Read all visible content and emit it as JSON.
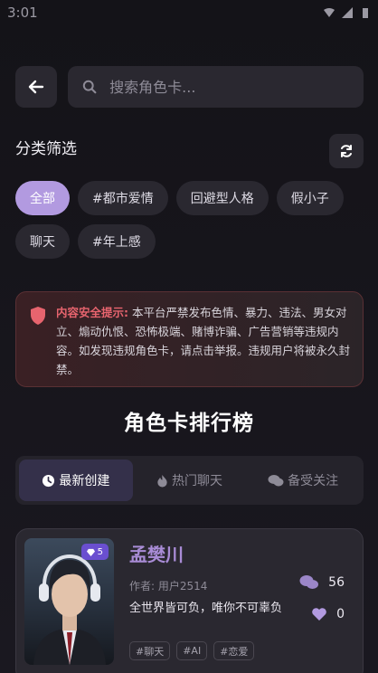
{
  "statusbar": {
    "time": "3:01"
  },
  "search": {
    "placeholder": "搜索角色卡..."
  },
  "filter": {
    "title": "分类筛选"
  },
  "chips": [
    {
      "label": "全部",
      "active": true
    },
    {
      "label": "#都市爱情",
      "active": false
    },
    {
      "label": "回避型人格",
      "active": false
    },
    {
      "label": "假小子",
      "active": false
    },
    {
      "label": "聊天",
      "active": false
    },
    {
      "label": "#年上感",
      "active": false
    }
  ],
  "notice": {
    "title": "内容安全提示:",
    "body": " 本平台严禁发布色情、暴力、违法、男女对立、煽动仇恨、恐怖极端、赌博诈骗、广告营销等违规内容。如发现违规角色卡，请点击举报。违规用户将被永久封禁。"
  },
  "ranking": {
    "title": "角色卡排行榜",
    "tabs": [
      {
        "label": "最新创建",
        "icon": "clock-icon",
        "active": true
      },
      {
        "label": "热门聊天",
        "icon": "flame-icon",
        "active": false
      },
      {
        "label": "备受关注",
        "icon": "comments-icon",
        "active": false
      }
    ]
  },
  "card": {
    "name": "孟樊川",
    "author": "作者: 用户2514",
    "description": "全世界皆可负，唯你不可辜负",
    "badge": "5",
    "chat_count": "56",
    "like_count": "0",
    "tags": [
      "#聊天",
      "#AI",
      "#恋爱"
    ]
  },
  "colors": {
    "accent": "#b29ae0",
    "warning": "#e7646e",
    "name": "#a98cd6"
  }
}
